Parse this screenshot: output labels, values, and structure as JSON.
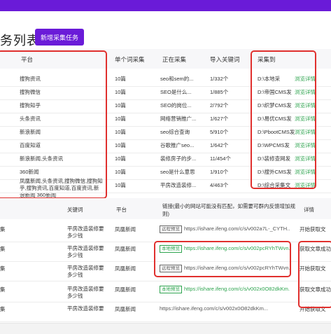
{
  "header": {
    "title": "务列表",
    "add_button": "新增采集任务"
  },
  "table1": {
    "columns": [
      "平台",
      "单个词采集",
      "正在采集",
      "导入关键词",
      "采集到"
    ],
    "rows": [
      {
        "platform": "搜狗资讯",
        "count": "10篇",
        "current": "seo和sem的...",
        "progress": "1/332个",
        "dest": "D:\\本地采",
        "link": "浏览详情"
      },
      {
        "platform": "搜狗微信",
        "count": "10篇",
        "current": "SEO是什么...",
        "progress": "1/885个",
        "dest": "D:\\帝国CMS发",
        "link": "浏览详情"
      },
      {
        "platform": "搜狗知乎",
        "count": "10篇",
        "current": "SEO的岗位...",
        "progress": "2/792个",
        "dest": "D:\\织梦CMS发",
        "link": "浏览详情"
      },
      {
        "platform": "头条资讯",
        "count": "10篇",
        "current": "网络营销推广...",
        "progress": "1/627个",
        "dest": "D:\\易优CMS发",
        "link": "浏览详情"
      },
      {
        "platform": "新浪新闻",
        "count": "10篇",
        "current": "seo综合查询",
        "progress": "5/910个",
        "dest": "D:\\PbootCMS发",
        "link": "浏览详情"
      },
      {
        "platform": "百度知道",
        "count": "10篇",
        "current": "谷歌推广seo...",
        "progress": "1/642个",
        "dest": "D:\\WPCMS发",
        "link": "浏览详情"
      },
      {
        "platform": "新浪新闻,头条资讯",
        "count": "10篇",
        "current": "装修房子的步...",
        "progress": "11/454个",
        "dest": "D:\\装修查网发",
        "link": "浏览详情"
      },
      {
        "platform": "360新闻",
        "count": "10篇",
        "current": "seo是什么意思",
        "progress": "1/910个",
        "dest": "D:\\搜外CMS发",
        "link": "浏览详情"
      },
      {
        "platform_lines": [
          "凤凰新闻,头条资讯,搜狗微信,搜狗知",
          "乎,搜狗资讯,百度知道,百度资讯,新",
          "浪新闻 360新闻"
        ],
        "count": "10篇",
        "current": "平房改造装修...",
        "progress": "4/463个",
        "dest": "D:\\综合采集文",
        "link": "浏览详情"
      }
    ]
  },
  "table2": {
    "columns": [
      "关键词",
      "平台",
      "链接(最小的网站可能没有匹配，如需要可群内反馈增加规则)",
      "详情"
    ],
    "col0": "集",
    "rows": [
      {
        "col0": "集",
        "keyword": [
          "平房改造装修要",
          "多少钱"
        ],
        "platform": "凤凰新闻",
        "tag": "远程预览",
        "tag_style": "gray",
        "url": "https://ishare.ifeng.com/c/s/v002a7L-_CYTH...",
        "url_style": "gray",
        "detail": "开始获取文"
      },
      {
        "col0": "集",
        "keyword": [
          "平房改造装修要",
          "多少钱"
        ],
        "platform": "凤凰新闻",
        "tag": "本地预览",
        "tag_style": "green",
        "url": "https://ishare.ifeng.com/c/s/v002pcRYhTWvn...",
        "url_style": "green",
        "detail": "获取文章成功"
      },
      {
        "col0": "集",
        "keyword": [
          "平房改造装修要",
          "多少钱"
        ],
        "platform": "凤凰新闻",
        "tag": "远程预览",
        "tag_style": "gray",
        "url": "https://ishare.ifeng.com/c/s/v002pcRYhTWvn...",
        "url_style": "gray",
        "detail": "开始获取文"
      },
      {
        "col0": "集",
        "keyword": [
          "平房改造装修要",
          "多少钱"
        ],
        "platform": "凤凰新闻",
        "tag": "本地预览",
        "tag_style": "green",
        "url": "https://ishare.ifeng.com/c/s/v002x0O82dkKm...",
        "url_style": "green",
        "detail": "获取文章成功"
      },
      {
        "col0": "集",
        "keyword": [
          "平房改造装修要"
        ],
        "platform": "凤凰新闻",
        "tag": "",
        "tag_style": "gray",
        "url": "https://ishare.ifeng.com/c/s/v002x0O82dkKm...",
        "url_style": "gray",
        "detail": "开始获取文"
      }
    ]
  },
  "colors": {
    "accent": "#6a1bd8",
    "highlight": "#e0302e",
    "link": "#2ea44f"
  }
}
